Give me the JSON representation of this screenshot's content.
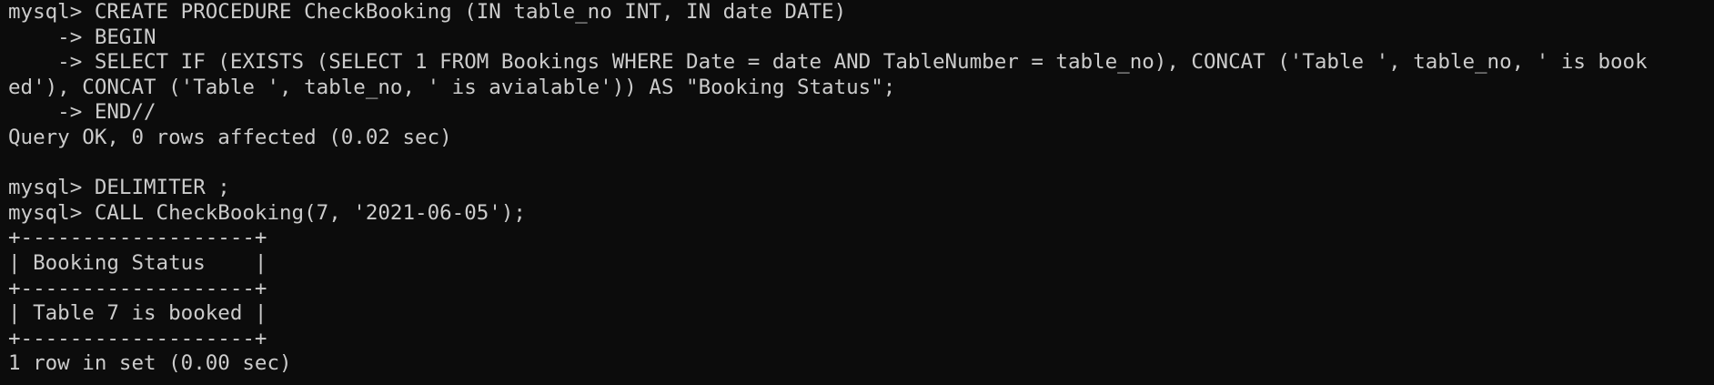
{
  "terminal": {
    "lines": [
      "mysql> CREATE PROCEDURE CheckBooking (IN table_no INT, IN date DATE)",
      "    -> BEGIN",
      "    -> SELECT IF (EXISTS (SELECT 1 FROM Bookings WHERE Date = date AND TableNumber = table_no), CONCAT ('Table ', table_no, ' is book",
      "ed'), CONCAT ('Table ', table_no, ' is avialable')) AS \"Booking Status\";",
      "    -> END//",
      "Query OK, 0 rows affected (0.02 sec)",
      "",
      "mysql> DELIMITER ;",
      "mysql> CALL CheckBooking(7, '2021-06-05');",
      "+-------------------+",
      "| Booking Status    |",
      "+-------------------+",
      "| Table 7 is booked |",
      "+-------------------+",
      "1 row in set (0.00 sec)"
    ]
  }
}
